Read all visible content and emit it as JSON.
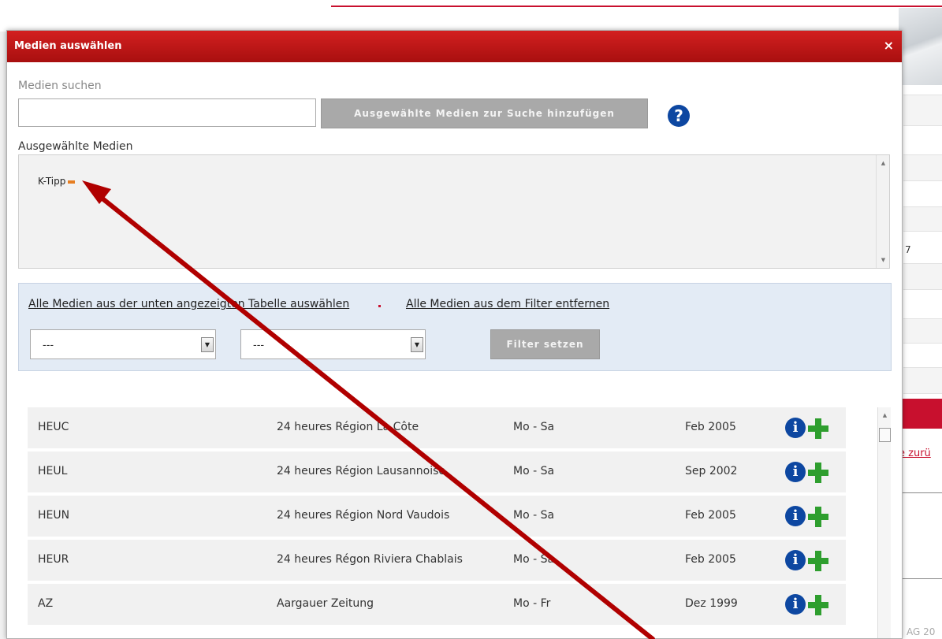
{
  "background_page": {
    "fragment_number": "7",
    "fragment_link": "e zurü",
    "footer_fragment": "AG 20"
  },
  "modal": {
    "title": "Medien auswählen",
    "close_glyph": "×",
    "search": {
      "label": "Medien suchen",
      "value": "",
      "placeholder": ""
    },
    "add_selected_button": "Ausgewählte Medien zur Suche hinzufügen",
    "help_glyph": "?",
    "selected": {
      "label": "Ausgewählte Medien",
      "items": [
        {
          "label": "K-Tipp"
        }
      ]
    },
    "filter": {
      "select_all_link": "Alle Medien aus der unten angezeigten Tabelle auswählen",
      "remove_all_link": "Alle Medien aus dem Filter entfernen",
      "select1_value": "---",
      "select2_value": "---",
      "set_filter_button": "Filter setzen"
    },
    "table": {
      "rows": [
        {
          "code": "HEUC",
          "name": "24 heures Région La Côte",
          "days": "Mo - Sa",
          "since": "Feb 2005"
        },
        {
          "code": "HEUL",
          "name": "24 heures Région Lausannoise",
          "days": "Mo - Sa",
          "since": "Sep 2002"
        },
        {
          "code": "HEUN",
          "name": "24 heures Région Nord Vaudois",
          "days": "Mo - Sa",
          "since": "Feb 2005"
        },
        {
          "code": "HEUR",
          "name": "24 heures Régon Riviera Chablais",
          "days": "Mo - Sa",
          "since": "Feb 2005"
        },
        {
          "code": "AZ",
          "name": "Aargauer Zeitung",
          "days": "Mo - Fr",
          "since": "Dez 1999"
        }
      ]
    }
  },
  "colors": {
    "titlebar": "#b51414",
    "accent_blue": "#0d47a1",
    "accent_green": "#2e9e2e",
    "annotation_arrow": "#b00000"
  },
  "icons": [
    "close-icon",
    "help-icon",
    "remove-icon",
    "info-icon",
    "plus-icon",
    "dropdown-arrow-icon"
  ]
}
